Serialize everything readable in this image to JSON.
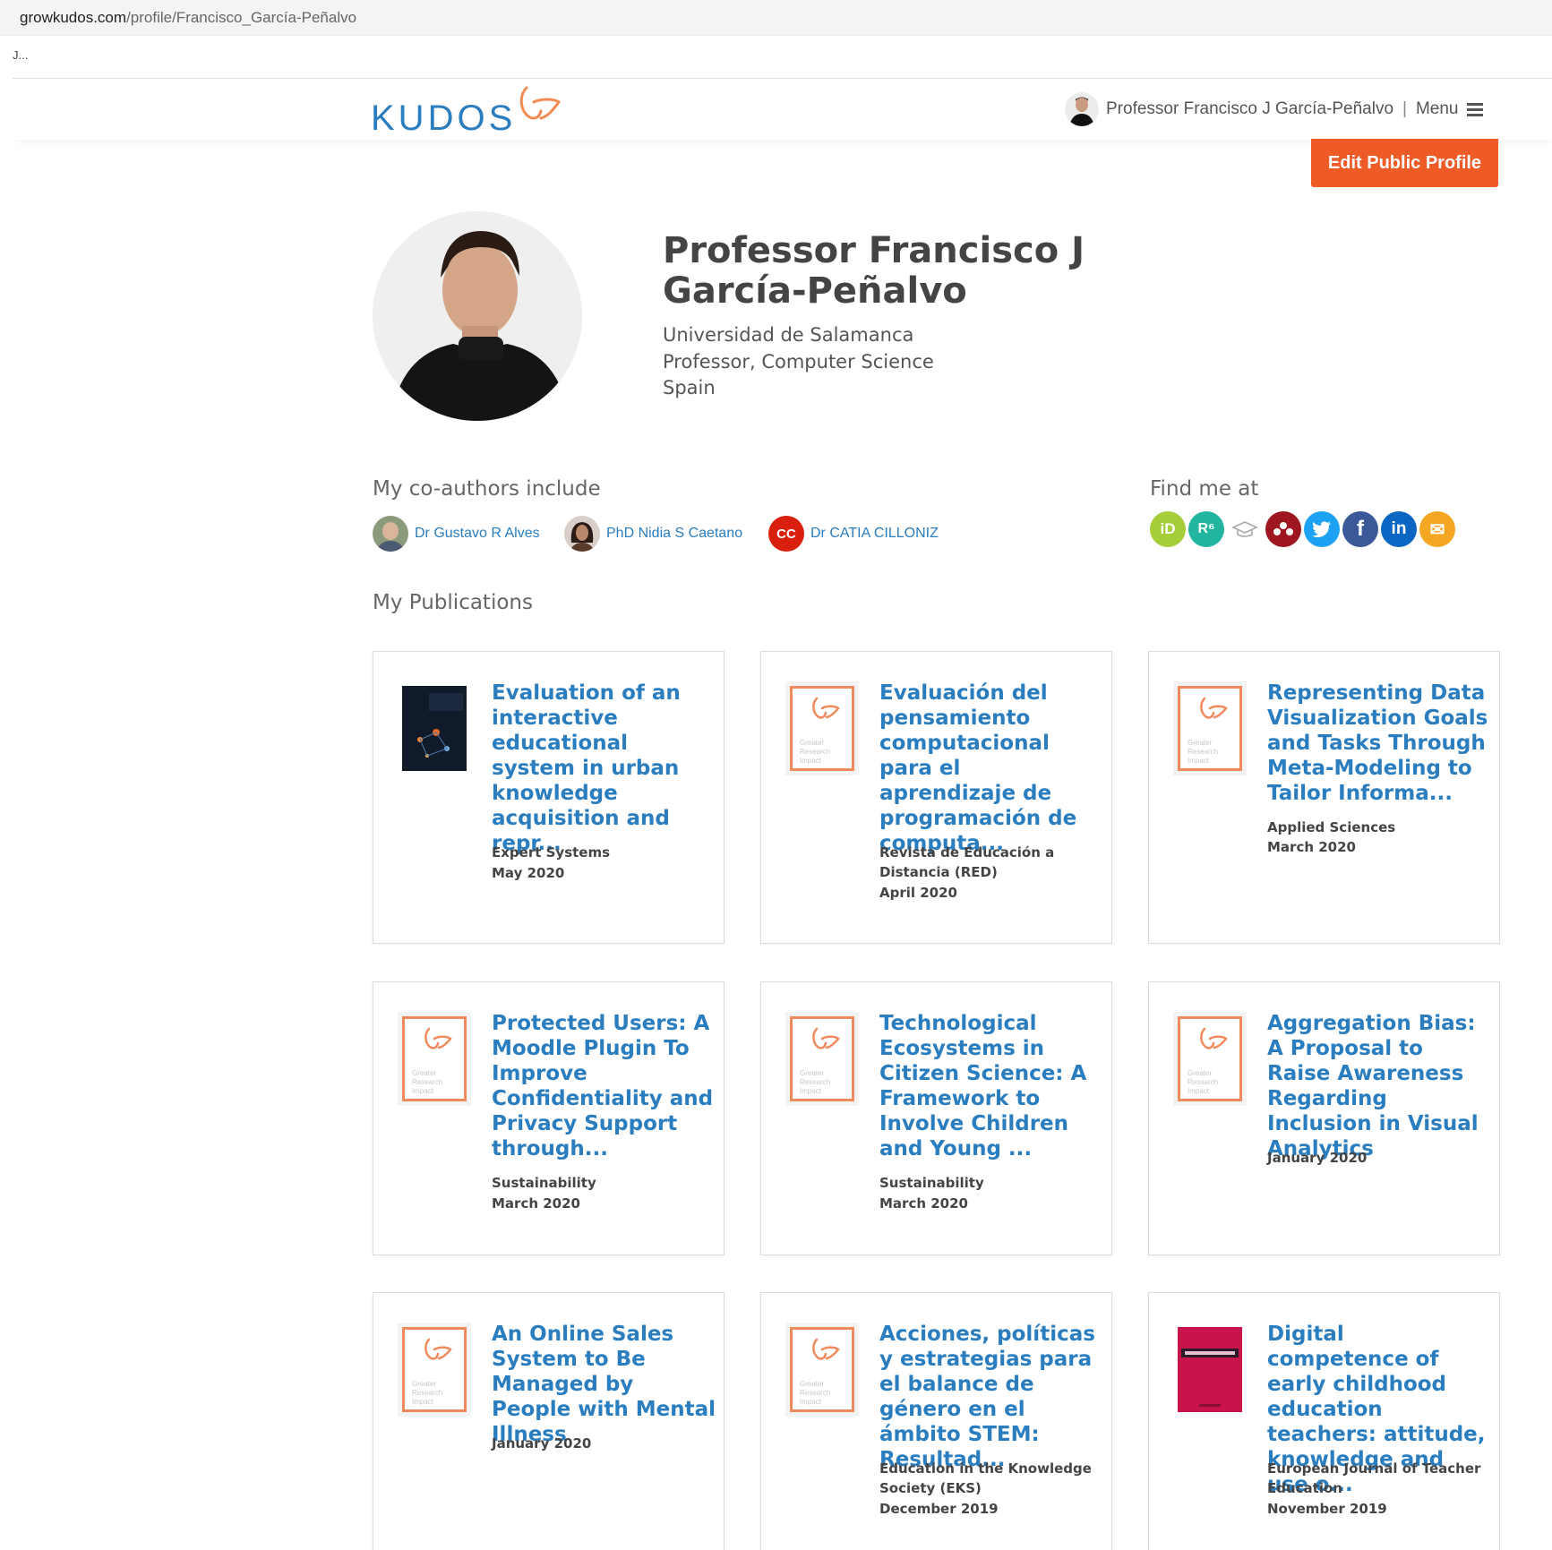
{
  "browser": {
    "url_host": "growkudos.com",
    "url_path": "/profile/Francisco_García-Peñalvo",
    "tab_text": "J..."
  },
  "header": {
    "logo_text": "KUDOS",
    "user_name": "Professor Francisco J García-Peñalvo",
    "separator": "|",
    "menu_label": "Menu",
    "brand_color": "#2a7dbf",
    "accent_color": "#ee5b27"
  },
  "edit_button_label": "Edit Public Profile",
  "profile": {
    "name": "Professor Francisco J García-Peñalvo",
    "institution": "Universidad de Salamanca",
    "position": "Professor, Computer Science",
    "country": "Spain"
  },
  "coauthors": {
    "title": "My co-authors include",
    "items": [
      {
        "name": "Dr Gustavo R Alves",
        "avatar": "photo"
      },
      {
        "name": "PhD Nidia S Caetano",
        "avatar": "photo"
      },
      {
        "name": "Dr CATIA CILLONIZ",
        "initials": "CC"
      }
    ]
  },
  "find_me": {
    "title": "Find me at",
    "links": [
      {
        "icon": "orcid-icon",
        "glyph": "iD",
        "color": "#a6ce39"
      },
      {
        "icon": "researchgate-icon",
        "glyph": "R⁶",
        "color": "#22b5a0"
      },
      {
        "icon": "scholar-cap-icon",
        "glyph": "🎓",
        "color": "#ffffff"
      },
      {
        "icon": "mendeley-icon",
        "glyph": "ⵘ",
        "color": "#9d1620"
      },
      {
        "icon": "twitter-icon",
        "glyph": "t",
        "color": "#1da1f2"
      },
      {
        "icon": "facebook-icon",
        "glyph": "f",
        "color": "#3b5998"
      },
      {
        "icon": "linkedin-icon",
        "glyph": "in",
        "color": "#0a66c2"
      },
      {
        "icon": "email-icon",
        "glyph": "✉",
        "color": "#f5a623"
      }
    ]
  },
  "publications": {
    "title": "My Publications",
    "thumb_default_label": "Greater Research Impact",
    "items": [
      {
        "title": "Evaluation of an interactive educational system in urban knowledge acquisition and repr...",
        "journal": "Expert Systems",
        "date": "May 2020",
        "thumb": "cover-expert-systems"
      },
      {
        "title": "Evaluación del pensamiento computacional para el aprendizaje de programación de computa...",
        "journal": "Revista de Educación a Distancia (RED)",
        "date": "April 2020",
        "thumb": "default"
      },
      {
        "title": "Representing Data Visualization Goals and Tasks Through Meta-Modeling to Tailor Informa...",
        "journal": "Applied Sciences",
        "date": "March 2020",
        "thumb": "default"
      },
      {
        "title": "Protected Users: A Moodle Plugin To Improve Confidentiality and Privacy Support through...",
        "journal": "Sustainability",
        "date": "March 2020",
        "thumb": "default"
      },
      {
        "title": "Technological Ecosystems in Citizen Science: A Framework to Involve Children and Young ...",
        "journal": "Sustainability",
        "date": "March 2020",
        "thumb": "default"
      },
      {
        "title": "Aggregation Bias: A Proposal to Raise Awareness Regarding Inclusion in Visual Analytics",
        "journal": "",
        "date": "January 2020",
        "thumb": "default"
      },
      {
        "title": "An Online Sales System to Be Managed by People with Mental Illness",
        "journal": "",
        "date": "January 2020",
        "thumb": "default"
      },
      {
        "title": "Acciones, políticas y estrategias para el balance de género en el ámbito STEM: Resultad...",
        "journal": "Education in the Knowledge Society (EKS)",
        "date": "December 2019",
        "thumb": "default"
      },
      {
        "title": "Digital competence of early childhood education teachers: attitude, knowledge and use o...",
        "journal": "European Journal of Teacher Education",
        "date": "November 2019",
        "thumb": "cover-ejte"
      }
    ]
  }
}
